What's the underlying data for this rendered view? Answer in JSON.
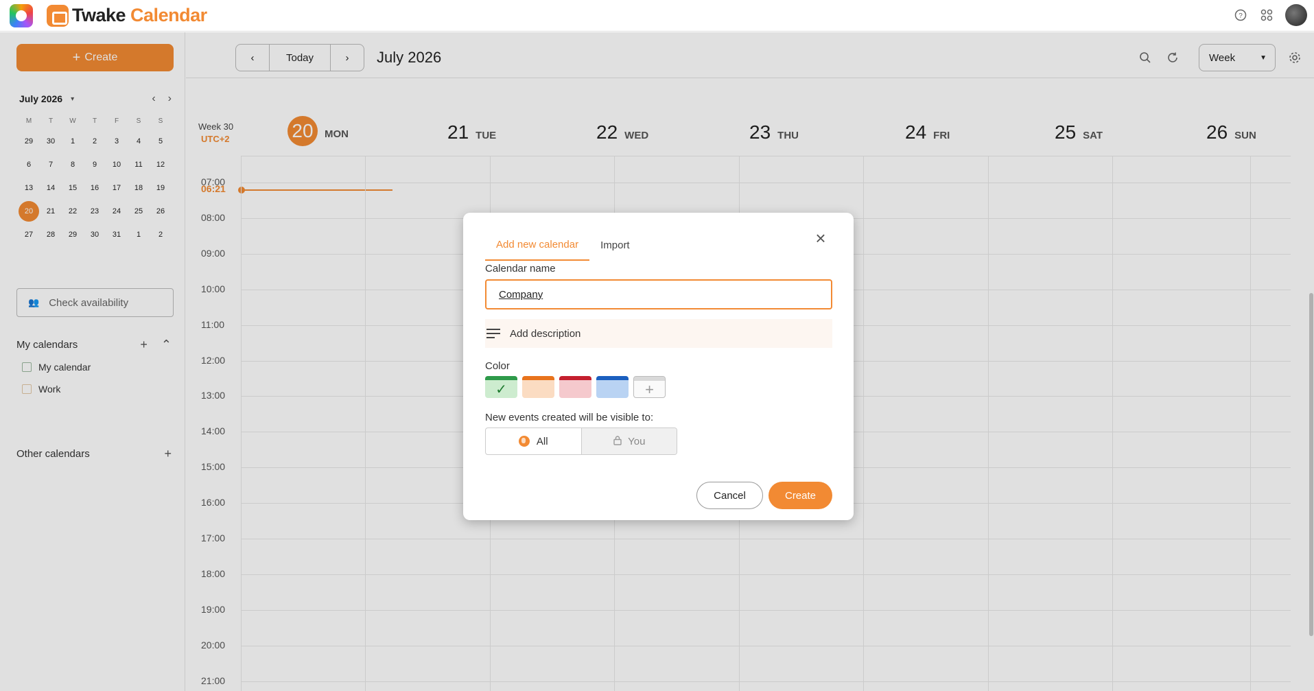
{
  "brand": {
    "name_part1": "Twake",
    "name_part2": "Calendar"
  },
  "sidebar": {
    "create_label": "Create",
    "mini_calendar": {
      "month_label": "July 2026",
      "weekdays": [
        "M",
        "T",
        "W",
        "T",
        "F",
        "S",
        "S"
      ],
      "days": [
        "29",
        "30",
        "1",
        "2",
        "3",
        "4",
        "5",
        "6",
        "7",
        "8",
        "9",
        "10",
        "11",
        "12",
        "13",
        "14",
        "15",
        "16",
        "17",
        "18",
        "19",
        "20",
        "21",
        "22",
        "23",
        "24",
        "25",
        "26",
        "27",
        "28",
        "29",
        "30",
        "31",
        "1",
        "2"
      ],
      "today": "20"
    },
    "check_availability_placeholder": "Check availability",
    "my_calendars_label": "My calendars",
    "calendars": [
      {
        "label": "My calendar"
      },
      {
        "label": "Work"
      }
    ],
    "other_calendars_label": "Other calendars"
  },
  "toolbar": {
    "today_label": "Today",
    "period_title": "July 2026",
    "view_label": "Week"
  },
  "week": {
    "week_label": "Week 30",
    "timezone": "UTC+2",
    "days": [
      {
        "num": "20",
        "dow": "MON",
        "today": true
      },
      {
        "num": "21",
        "dow": "TUE"
      },
      {
        "num": "22",
        "dow": "WED"
      },
      {
        "num": "23",
        "dow": "THU"
      },
      {
        "num": "24",
        "dow": "FRI"
      },
      {
        "num": "25",
        "dow": "SAT"
      },
      {
        "num": "26",
        "dow": "SUN"
      }
    ],
    "current_time": "06:21",
    "hours": [
      "07:00",
      "08:00",
      "09:00",
      "10:00",
      "11:00",
      "12:00",
      "13:00",
      "14:00",
      "15:00",
      "16:00",
      "17:00",
      "18:00",
      "19:00",
      "20:00",
      "21:00"
    ]
  },
  "dialog": {
    "tab_add": "Add new calendar",
    "tab_import": "Import",
    "name_label": "Calendar name",
    "name_value": "Company",
    "description_label": "Add description",
    "color_label": "Color",
    "colors": [
      {
        "top": "#2e9a4a",
        "fill": "#cdeccf",
        "selected": true
      },
      {
        "top": "#e8731c",
        "fill": "#fbdcc2"
      },
      {
        "top": "#c41f2e",
        "fill": "#f5c9cd"
      },
      {
        "top": "#1b5fbf",
        "fill": "#b9d3f3"
      }
    ],
    "visibility_label": "New events created will be visible to:",
    "visibility_all": "All",
    "visibility_you": "You",
    "cancel_label": "Cancel",
    "create_label": "Create"
  }
}
